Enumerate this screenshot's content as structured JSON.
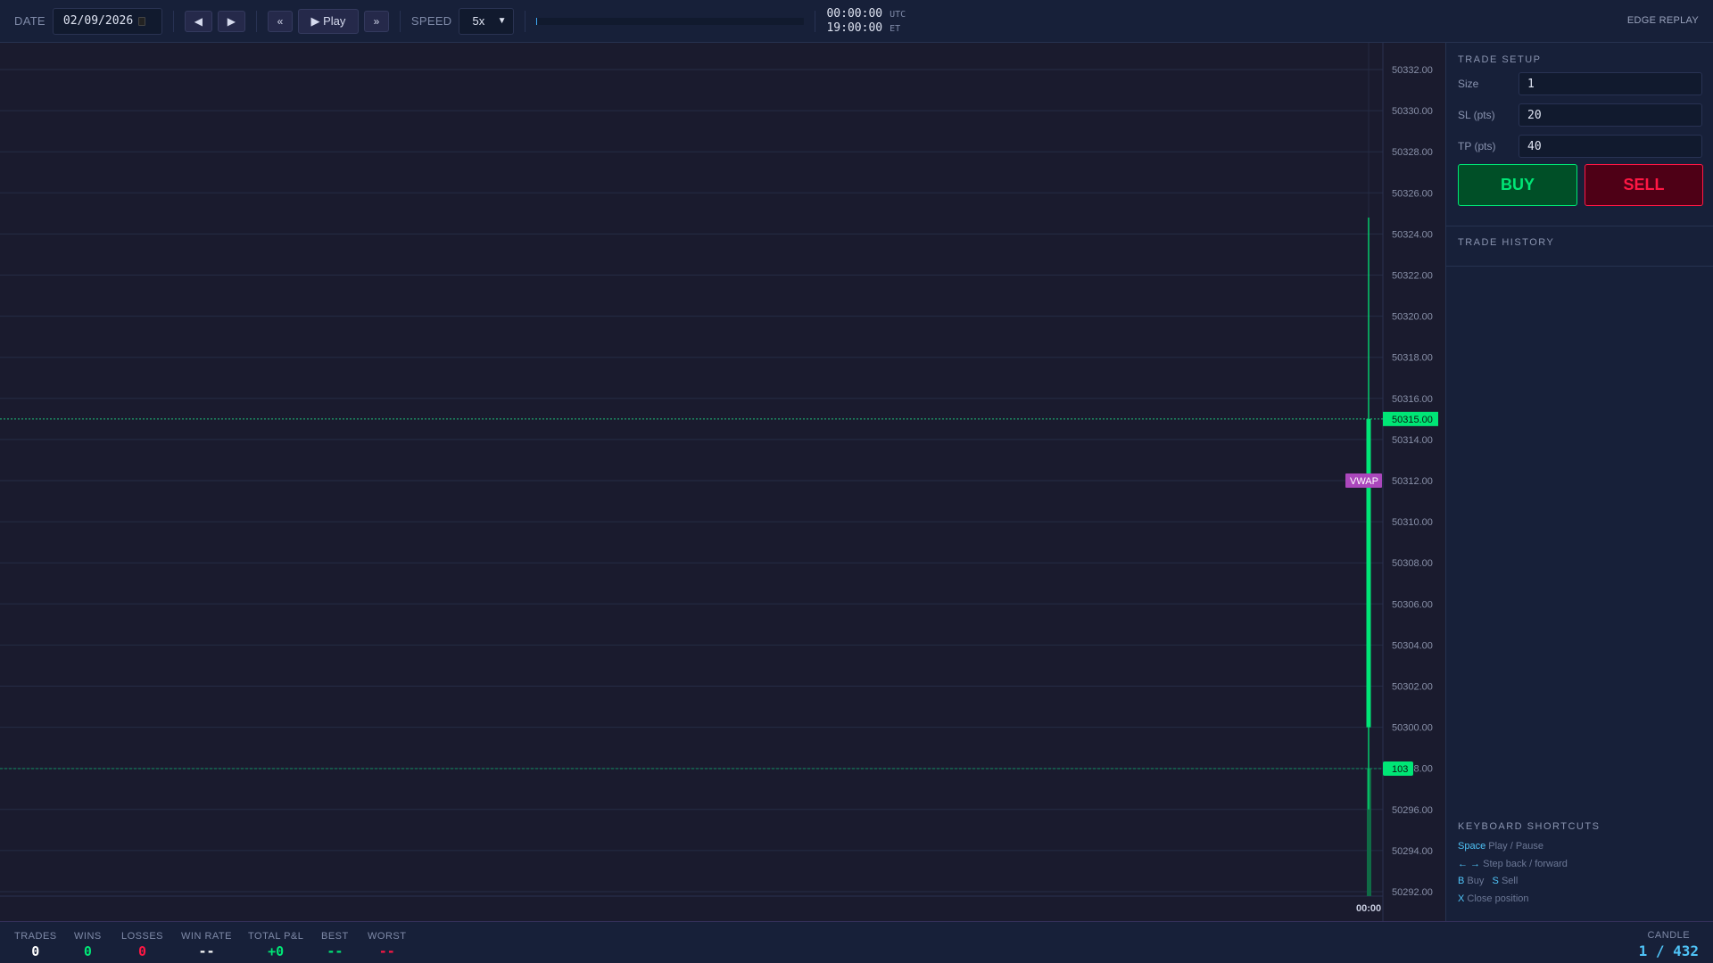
{
  "topbar": {
    "date_label": "DATE",
    "date_value": "02/09/2026",
    "step_back": "◀",
    "step_forward": "▶",
    "rewind": "«",
    "play": "▶ Play",
    "fast_forward": "»",
    "speed_label": "SPEED",
    "speed_value": "5x",
    "progress_percent": 0.2,
    "time_utc": "00:00:00",
    "utc_label": "UTC",
    "time_et": "19:00:00",
    "et_label": "ET",
    "brand": "EDGE REPLAY"
  },
  "chart_data": {
    "type": "candlestick",
    "y_ticks": [
      "50332.00",
      "50330.00",
      "50328.00",
      "50326.00",
      "50324.00",
      "50322.00",
      "50320.00",
      "50318.00",
      "50316.00",
      "50314.00",
      "50312.00",
      "50310.00",
      "50308.00",
      "50306.00",
      "50304.00",
      "50302.00",
      "50300.00",
      "50298.00",
      "50296.00",
      "50294.00",
      "50292.00"
    ],
    "ylim": [
      50291,
      50333.5
    ],
    "x_tick": "00:00",
    "candles": [
      {
        "time": "00:00",
        "open": 50300,
        "high": 50324.8,
        "low": 50296,
        "close": 50315,
        "volume": 103
      }
    ],
    "last_price_label": "50315.00",
    "volume_label": "103",
    "vwap_label": "VWAP",
    "vwap": 50312,
    "colors": {
      "up": "#00e676",
      "vwap": "#ab47bc",
      "grid": "#252c45"
    }
  },
  "trade_setup": {
    "title": "TRADE SETUP",
    "size_label": "Size",
    "size_value": "1",
    "sl_label": "SL (pts)",
    "sl_value": "20",
    "tp_label": "TP (pts)",
    "tp_value": "40",
    "buy": "BUY",
    "sell": "SELL"
  },
  "trade_history": {
    "title": "TRADE HISTORY"
  },
  "shortcuts": {
    "title": "KEYBOARD SHORTCUTS",
    "items": [
      {
        "key": "Space",
        "desc": "Play / Pause"
      },
      {
        "key": "← →",
        "desc": "Step back / forward"
      },
      {
        "key": "B",
        "desc": "Buy"
      },
      {
        "key": "S",
        "desc": "Sell"
      },
      {
        "key": "X",
        "desc": "Close position"
      }
    ]
  },
  "stats": [
    {
      "label": "TRADES",
      "value": "0",
      "color": "#ffffff"
    },
    {
      "label": "WINS",
      "value": "0",
      "color": "#00e676"
    },
    {
      "label": "LOSSES",
      "value": "0",
      "color": "#ff1744"
    },
    {
      "label": "WIN RATE",
      "value": "--",
      "color": "#ffffff"
    },
    {
      "label": "TOTAL P&L",
      "value": "+0",
      "color": "#00e676"
    },
    {
      "label": "BEST",
      "value": "--",
      "color": "#00e676"
    },
    {
      "label": "WORST",
      "value": "--",
      "color": "#ff1744"
    }
  ],
  "candle_counter": {
    "label": "CANDLE",
    "value": "1 / 432"
  }
}
